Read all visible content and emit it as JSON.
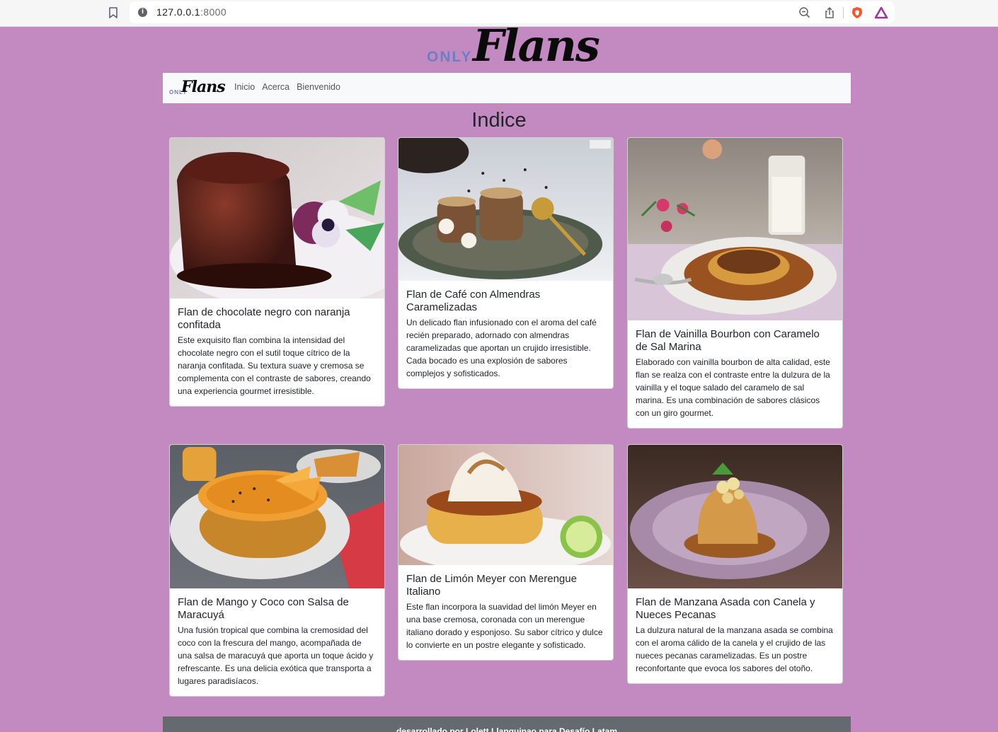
{
  "browser": {
    "url_host": "127.0.0.1",
    "url_port": ":8000"
  },
  "brand": {
    "only": "ONLY",
    "flans": "Flans"
  },
  "nav": {
    "links": [
      "Inicio",
      "Acerca",
      "Bienvenido"
    ]
  },
  "page": {
    "title": "Indice"
  },
  "cards": [
    {
      "title": "Flan de chocolate negro con naranja confitada",
      "text": "Este exquisito flan combina la intensidad del chocolate negro con el sutil toque cítrico de la naranja confitada. Su textura suave y cremosa se complementa con el contraste de sabores, creando una experiencia gourmet irresistible."
    },
    {
      "title": "Flan de Café con Almendras Caramelizadas",
      "text": "Un delicado flan infusionado con el aroma del café recién preparado, adornado con almendras caramelizadas que aportan un crujido irresistible. Cada bocado es una explosión de sabores complejos y sofisticados."
    },
    {
      "title": "Flan de Vainilla Bourbon con Caramelo de Sal Marina",
      "text": "Elaborado con vainilla bourbon de alta calidad, este flan se realza con el contraste entre la dulzura de la vainilla y el toque salado del caramelo de sal marina. Es una combinación de sabores clásicos con un giro gourmet."
    },
    {
      "title": "Flan de Mango y Coco con Salsa de Maracuyá",
      "text": "Una fusión tropical que combina la cremosidad del coco con la frescura del mango, acompañada de una salsa de maracuyá que aporta un toque ácido y refrescante. Es una delicia exótica que transporta a lugares paradisíacos."
    },
    {
      "title": "Flan de Limón Meyer con Merengue Italiano",
      "text": "Este flan incorpora la suavidad del limón Meyer en una base cremosa, coronada con un merengue italiano dorado y esponjoso. Su sabor cítrico y dulce lo convierte en un postre elegante y sofisticado."
    },
    {
      "title": "Flan de Manzana Asada con Canela y Nueces Pecanas",
      "text": "La dulzura natural de la manzana asada se combina con el aroma cálido de la canela y el crujido de las nueces pecanas caramelizadas. Es un postre reconfortante que evoca los sabores del otoño."
    }
  ],
  "footer": {
    "text": "desarrollado por Lolett Llanquinao para Desafío Latam"
  }
}
